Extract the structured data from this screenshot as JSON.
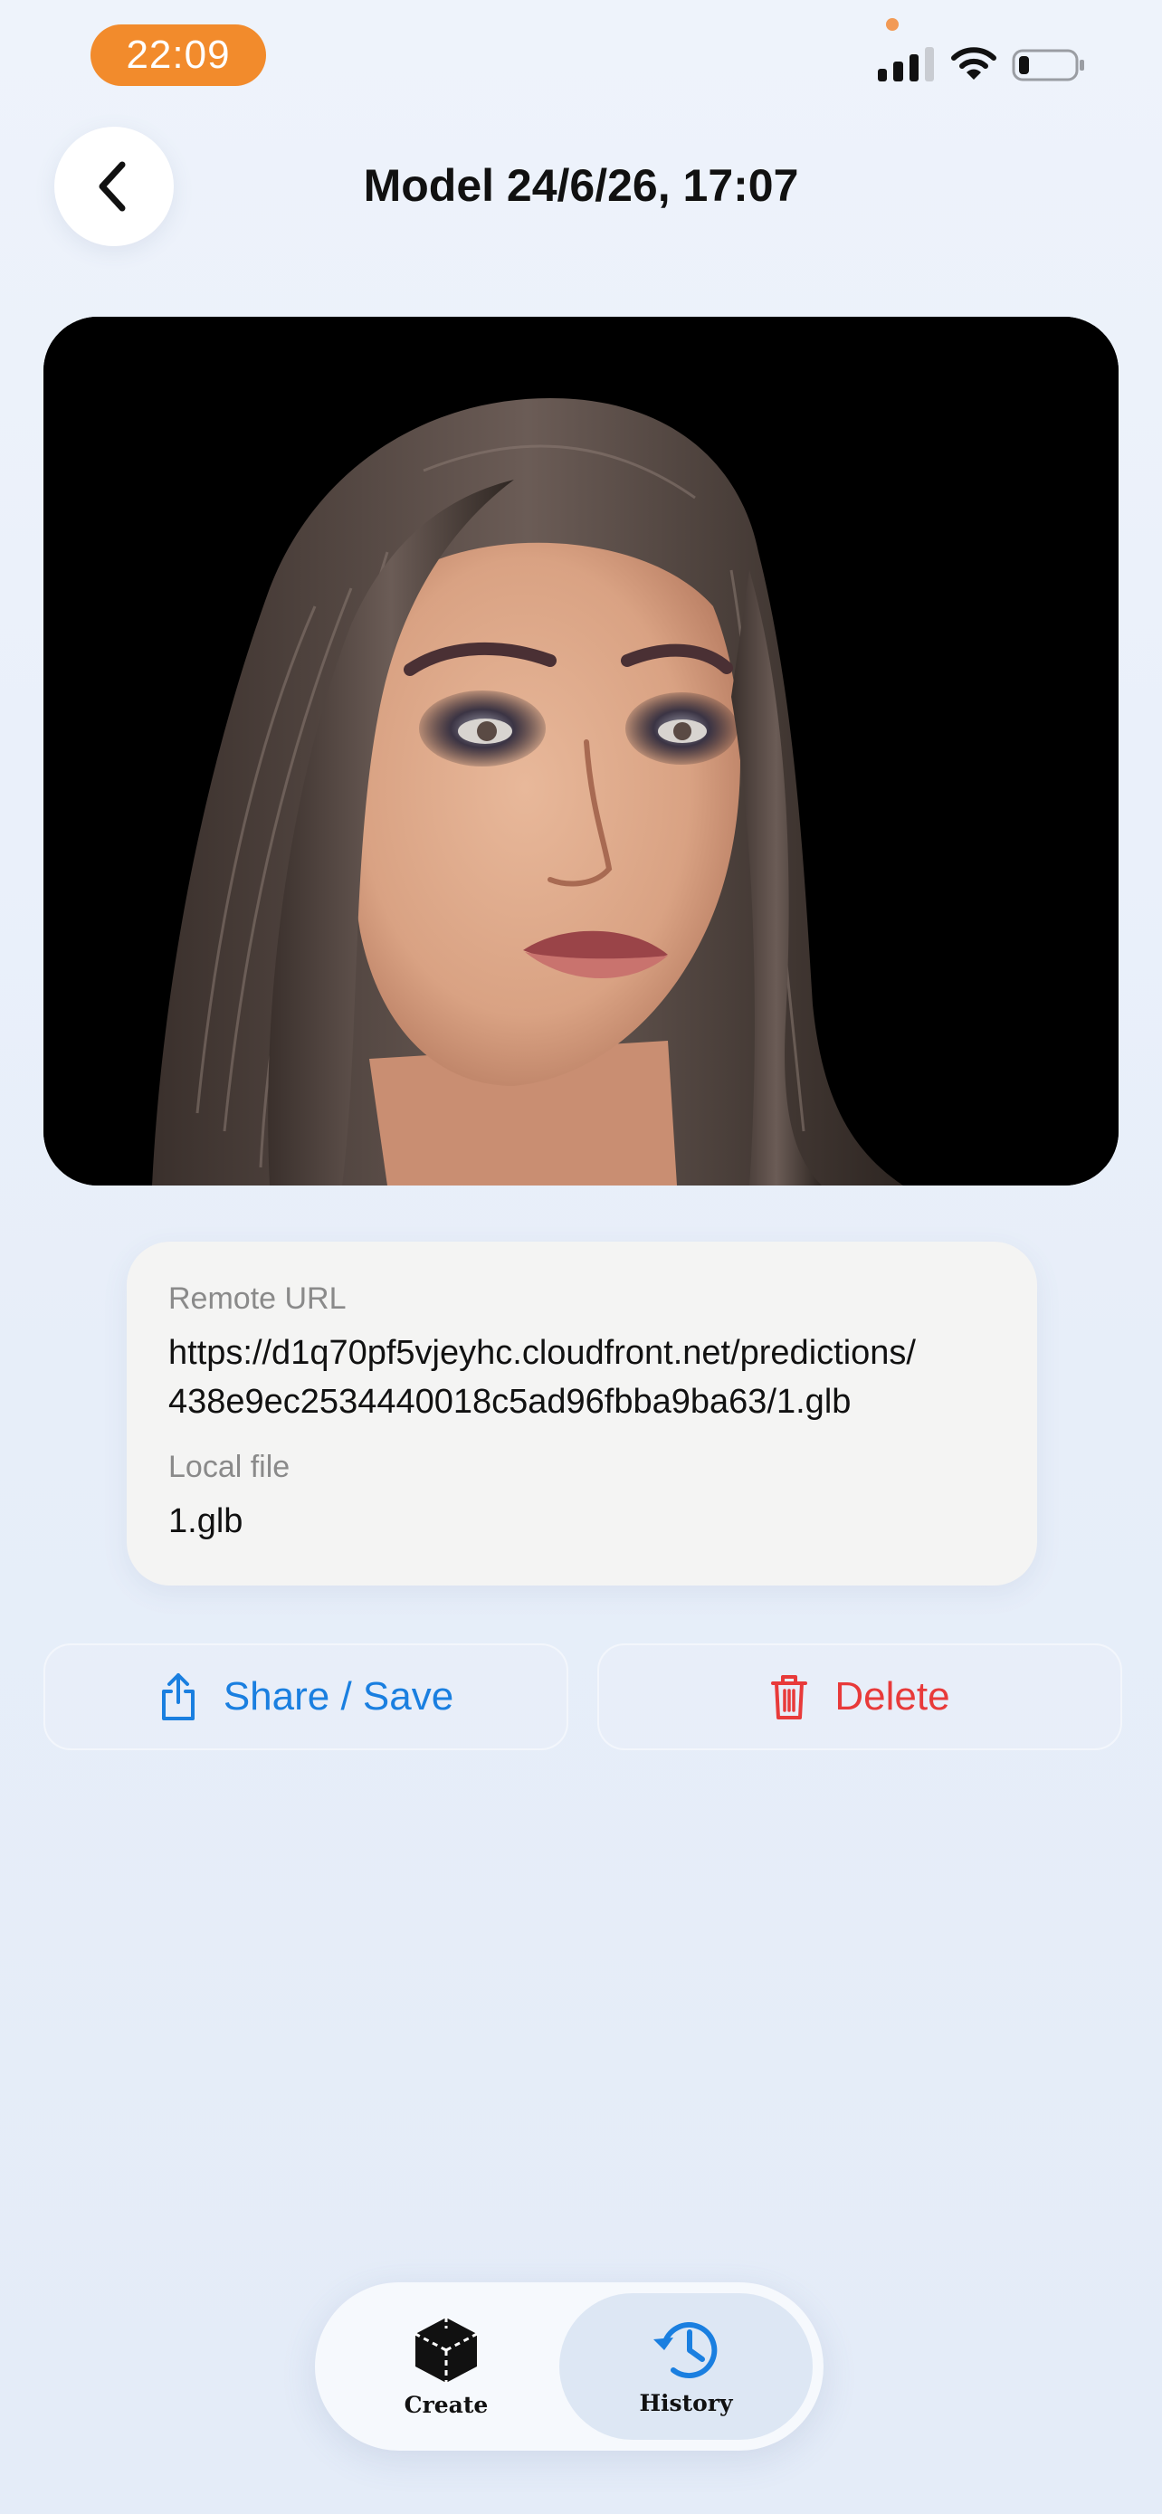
{
  "status_bar": {
    "time": "22:09"
  },
  "header": {
    "title": "Model 24/6/26, 17:07"
  },
  "preview": {
    "description_icon": "3d-model-render"
  },
  "info": {
    "remote_url_label": "Remote URL",
    "remote_url_line1": "https://d1q70pf5vjeyhc.cloudfront.net/predictions/",
    "remote_url_line2": "438e9ec2534440018c5ad96fbba9ba63/1.glb",
    "local_file_label": "Local file",
    "local_file_value": "1.glb"
  },
  "actions": {
    "share_label": "Share / Save",
    "delete_label": "Delete"
  },
  "tabs": {
    "create_label": "Create",
    "history_label": "History",
    "active": "History"
  },
  "colors": {
    "accent_blue": "#1a7fe0",
    "danger_red": "#e83a3a",
    "time_pill": "#f28b2c"
  }
}
